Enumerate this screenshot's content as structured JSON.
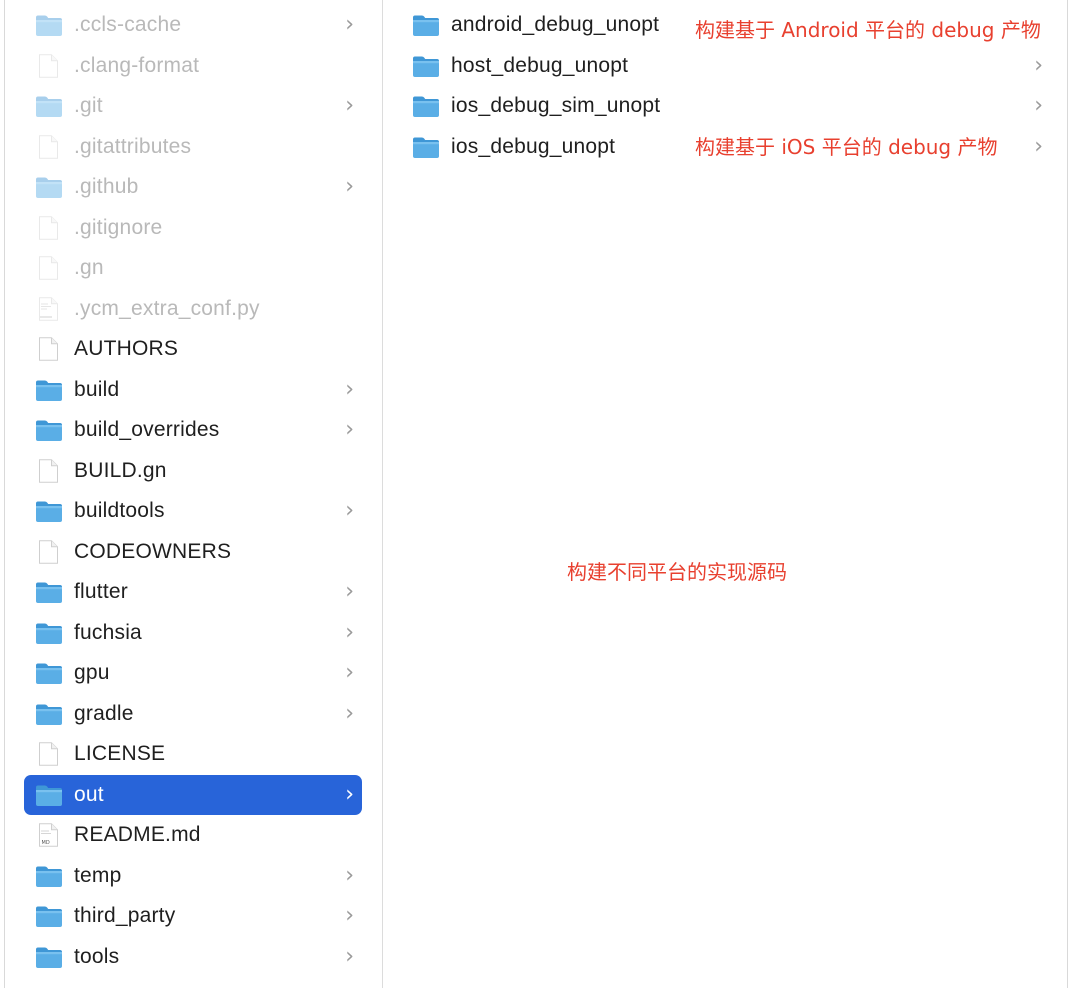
{
  "left_column": {
    "items": [
      {
        "name": ".ccls-cache",
        "kind": "folder",
        "hidden": true,
        "chevron": true
      },
      {
        "name": ".clang-format",
        "kind": "file",
        "hidden": true,
        "chevron": false
      },
      {
        "name": ".git",
        "kind": "folder",
        "hidden": true,
        "chevron": true
      },
      {
        "name": ".gitattributes",
        "kind": "file",
        "hidden": true,
        "chevron": false
      },
      {
        "name": ".github",
        "kind": "folder",
        "hidden": true,
        "chevron": true
      },
      {
        "name": ".gitignore",
        "kind": "file",
        "hidden": true,
        "chevron": false
      },
      {
        "name": ".gn",
        "kind": "file",
        "hidden": true,
        "chevron": false
      },
      {
        "name": ".ycm_extra_conf.py",
        "kind": "pyfile",
        "hidden": true,
        "chevron": false
      },
      {
        "name": "AUTHORS",
        "kind": "file",
        "hidden": false,
        "chevron": false
      },
      {
        "name": "build",
        "kind": "folder",
        "hidden": false,
        "chevron": true
      },
      {
        "name": "build_overrides",
        "kind": "folder",
        "hidden": false,
        "chevron": true
      },
      {
        "name": "BUILD.gn",
        "kind": "file",
        "hidden": false,
        "chevron": false
      },
      {
        "name": "buildtools",
        "kind": "folder",
        "hidden": false,
        "chevron": true
      },
      {
        "name": "CODEOWNERS",
        "kind": "file",
        "hidden": false,
        "chevron": false
      },
      {
        "name": "flutter",
        "kind": "folder",
        "hidden": false,
        "chevron": true
      },
      {
        "name": "fuchsia",
        "kind": "folder",
        "hidden": false,
        "chevron": true
      },
      {
        "name": "gpu",
        "kind": "folder",
        "hidden": false,
        "chevron": true
      },
      {
        "name": "gradle",
        "kind": "folder",
        "hidden": false,
        "chevron": true
      },
      {
        "name": "LICENSE",
        "kind": "file",
        "hidden": false,
        "chevron": false
      },
      {
        "name": "out",
        "kind": "folder",
        "hidden": false,
        "chevron": true,
        "selected": true
      },
      {
        "name": "README.md",
        "kind": "mdfile",
        "hidden": false,
        "chevron": false
      },
      {
        "name": "temp",
        "kind": "folder",
        "hidden": false,
        "chevron": true
      },
      {
        "name": "third_party",
        "kind": "folder",
        "hidden": false,
        "chevron": true
      },
      {
        "name": "tools",
        "kind": "folder",
        "hidden": false,
        "chevron": true
      }
    ]
  },
  "right_column": {
    "items": [
      {
        "name": "android_debug_unopt",
        "kind": "folder",
        "chevron": false
      },
      {
        "name": "host_debug_unopt",
        "kind": "folder",
        "chevron": true
      },
      {
        "name": "ios_debug_sim_unopt",
        "kind": "folder",
        "chevron": true
      },
      {
        "name": "ios_debug_unopt",
        "kind": "folder",
        "chevron": true
      }
    ]
  },
  "annotations": {
    "android": "构建基于 Android 平台的 debug 产物",
    "ios": "构建基于 iOS 平台的 debug 产物",
    "center": "构建不同平台的实现源码"
  },
  "chevron_glyph": "›",
  "colors": {
    "selection": "#2864d9",
    "folder_body": "#5aaee6",
    "folder_tab": "#3f97d6",
    "annotation": "#e8402f"
  }
}
